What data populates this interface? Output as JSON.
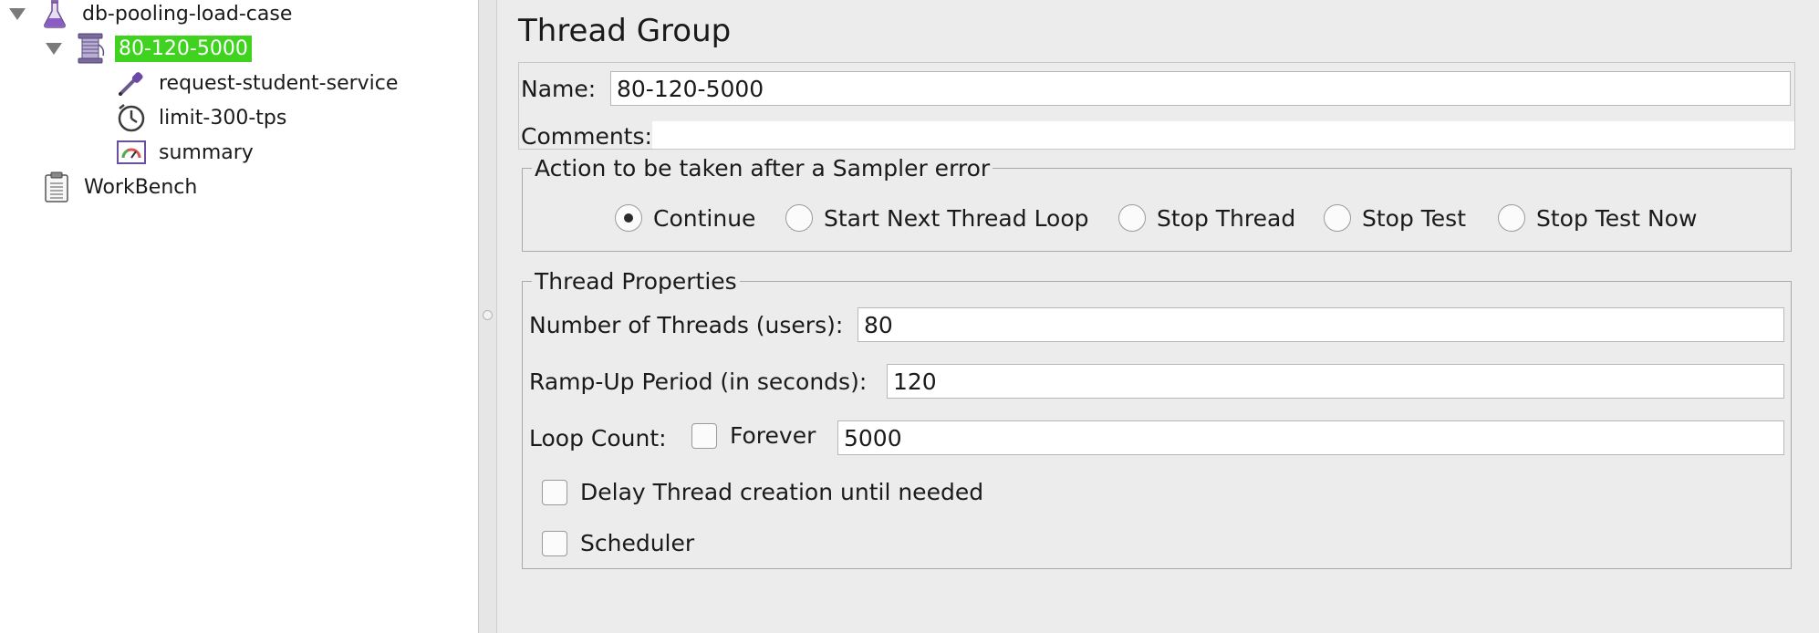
{
  "tree": {
    "root": {
      "label": "db-pooling-load-case",
      "icon": "flask-icon"
    },
    "thread_group": {
      "label": "80-120-5000",
      "icon": "spool-icon",
      "selected": true
    },
    "children": [
      {
        "label": "request-student-service",
        "icon": "pipette-icon"
      },
      {
        "label": "limit-300-tps",
        "icon": "timer-icon"
      },
      {
        "label": "summary",
        "icon": "gauge-icon"
      }
    ],
    "workbench": {
      "label": "WorkBench",
      "icon": "clipboard-icon"
    }
  },
  "panel": {
    "title": "Thread Group",
    "name_label": "Name:",
    "name_value": "80-120-5000",
    "comments_label": "Comments:",
    "comments_value": "",
    "sampler_error": {
      "legend": "Action to be taken after a Sampler error",
      "options": [
        {
          "label": "Continue",
          "selected": true
        },
        {
          "label": "Start Next Thread Loop",
          "selected": false
        },
        {
          "label": "Stop Thread",
          "selected": false
        },
        {
          "label": "Stop Test",
          "selected": false
        },
        {
          "label": "Stop Test Now",
          "selected": false
        }
      ]
    },
    "thread_properties": {
      "legend": "Thread Properties",
      "threads_label": "Number of Threads (users):",
      "threads_value": "80",
      "rampup_label": "Ramp-Up Period (in seconds):",
      "rampup_value": "120",
      "loop_label": "Loop Count:",
      "forever_label": "Forever",
      "forever_checked": false,
      "loop_value": "5000",
      "delay_label": "Delay Thread creation until needed",
      "delay_checked": false,
      "scheduler_label": "Scheduler",
      "scheduler_checked": false
    }
  },
  "colors": {
    "selection": "#3fd21f",
    "panel_bg": "#ececec",
    "tree_bg": "#ffffff"
  }
}
